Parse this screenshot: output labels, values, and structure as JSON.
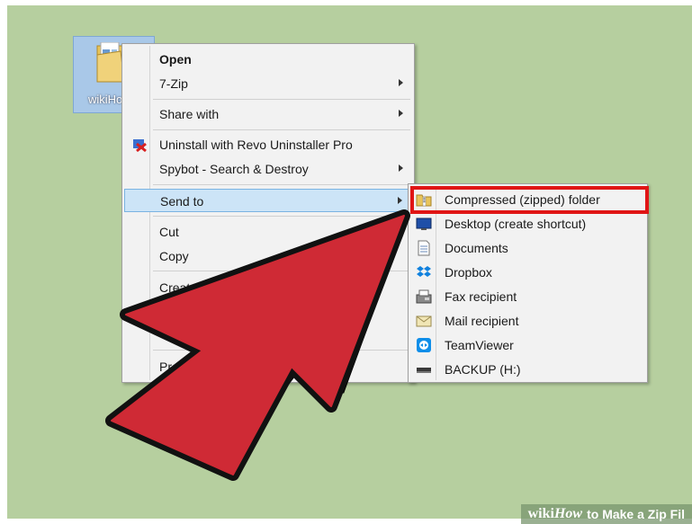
{
  "desktop": {
    "folder_label": "wikiHo"
  },
  "context_menu": {
    "items": [
      {
        "label": "Open"
      },
      {
        "label": "7-Zip"
      },
      {
        "label": "Share with"
      },
      {
        "label": "Uninstall with Revo Uninstaller Pro"
      },
      {
        "label": "Spybot - Search & Destroy"
      },
      {
        "label": "Send to"
      },
      {
        "label": "Cut"
      },
      {
        "label": "Copy"
      },
      {
        "label": "Create sh"
      },
      {
        "label": "Properti"
      }
    ]
  },
  "send_to_menu": {
    "items": [
      {
        "label": "Compressed (zipped) folder",
        "icon": "zip-folder-icon"
      },
      {
        "label": "Desktop (create shortcut)",
        "icon": "desktop-icon"
      },
      {
        "label": "Documents",
        "icon": "documents-icon"
      },
      {
        "label": "Dropbox",
        "icon": "dropbox-icon"
      },
      {
        "label": "Fax recipient",
        "icon": "fax-icon"
      },
      {
        "label": "Mail recipient",
        "icon": "mail-icon"
      },
      {
        "label": "TeamViewer",
        "icon": "teamviewer-icon"
      },
      {
        "label": "BACKUP (H:)",
        "icon": "drive-icon"
      }
    ]
  },
  "banner": {
    "wiki": "wiki",
    "how": "How",
    "title": "to Make a Zip Fil"
  },
  "colors": {
    "desktop": "#b6cf9f",
    "highlight": "#cce4f7",
    "callout_box": "#e01515",
    "arrow": "#cf2a35"
  }
}
